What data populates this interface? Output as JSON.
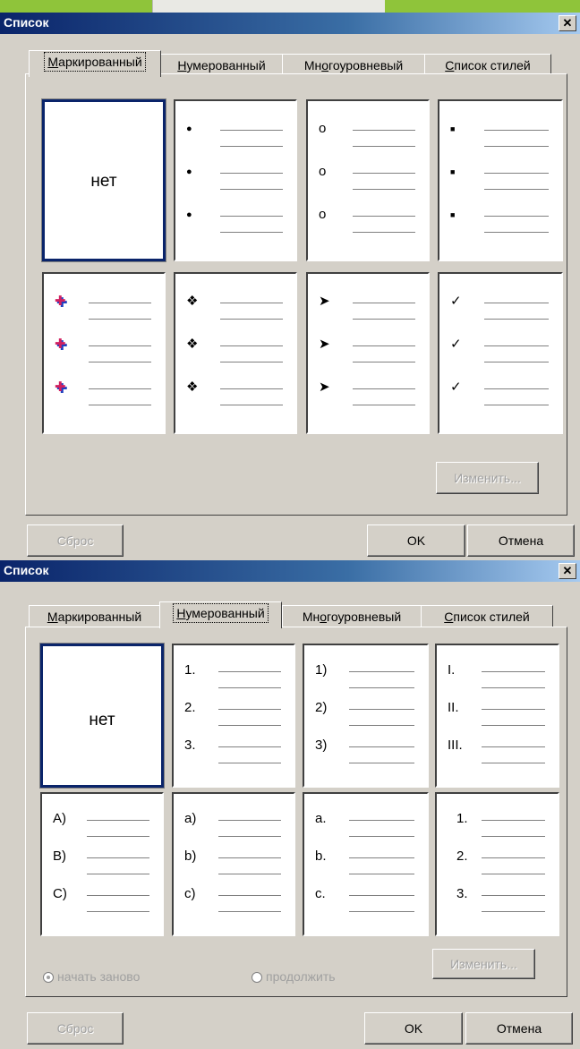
{
  "dialogs": [
    {
      "title": "Список",
      "close_glyph": "✕",
      "tabs": [
        {
          "pre": "",
          "acc": "М",
          "post": "аркированный",
          "active": true
        },
        {
          "pre": "",
          "acc": "Н",
          "post": "умерованный",
          "active": false
        },
        {
          "pre": "Мн",
          "acc": "о",
          "post": "гоуровневый",
          "active": false
        },
        {
          "pre": "",
          "acc": "С",
          "post": "писок стилей",
          "active": false
        }
      ],
      "none_label": "нет",
      "styles": [
        {
          "kind": "none"
        },
        {
          "kind": "bullet",
          "name": "filled-dot",
          "markers": [
            "●",
            "●",
            "●"
          ]
        },
        {
          "kind": "bullet",
          "name": "hollow-circle",
          "markers": [
            "o",
            "o",
            "o"
          ]
        },
        {
          "kind": "bullet",
          "name": "filled-square",
          "markers": [
            "■",
            "■",
            "■"
          ]
        },
        {
          "kind": "bullet",
          "name": "color-pin",
          "markers": [
            "✚",
            "✚",
            "✚"
          ]
        },
        {
          "kind": "bullet",
          "name": "four-diamond",
          "markers": [
            "❖",
            "❖",
            "❖"
          ]
        },
        {
          "kind": "bullet",
          "name": "arrowhead",
          "markers": [
            "➤",
            "➤",
            "➤"
          ]
        },
        {
          "kind": "bullet",
          "name": "checkmark",
          "markers": [
            "✓",
            "✓",
            "✓"
          ]
        }
      ],
      "buttons": {
        "modify": "Изменить...",
        "reset": "Сброс",
        "ok": "OK",
        "cancel": "Отмена"
      }
    },
    {
      "title": "Список",
      "close_glyph": "✕",
      "tabs": [
        {
          "pre": "",
          "acc": "М",
          "post": "аркированный",
          "active": false
        },
        {
          "pre": "",
          "acc": "Н",
          "post": "умерованный",
          "active": true
        },
        {
          "pre": "Мн",
          "acc": "о",
          "post": "гоуровневый",
          "active": false
        },
        {
          "pre": "",
          "acc": "С",
          "post": "писок стилей",
          "active": false
        }
      ],
      "none_label": "нет",
      "styles": [
        {
          "kind": "none"
        },
        {
          "kind": "number",
          "name": "arabic-dot",
          "markers": [
            "1.",
            "2.",
            "3."
          ]
        },
        {
          "kind": "number",
          "name": "arabic-paren",
          "markers": [
            "1)",
            "2)",
            "3)"
          ]
        },
        {
          "kind": "number",
          "name": "roman-upper",
          "markers": [
            "I.",
            "II.",
            "III."
          ]
        },
        {
          "kind": "number",
          "name": "alpha-upper-paren",
          "markers": [
            "A)",
            "B)",
            "C)"
          ]
        },
        {
          "kind": "number",
          "name": "alpha-lower-paren",
          "markers": [
            "a)",
            "b)",
            "c)"
          ]
        },
        {
          "kind": "number",
          "name": "alpha-lower-dot",
          "markers": [
            "a.",
            "b.",
            "c."
          ]
        },
        {
          "kind": "number",
          "name": "arabic-dot-indented",
          "markers": [
            "1.",
            "2.",
            "3."
          ]
        }
      ],
      "radios": [
        {
          "label": "начать заново",
          "checked": true
        },
        {
          "label": "продолжить",
          "checked": false
        }
      ],
      "buttons": {
        "modify": "Изменить...",
        "reset": "Сброс",
        "ok": "OK",
        "cancel": "Отмена"
      }
    }
  ]
}
